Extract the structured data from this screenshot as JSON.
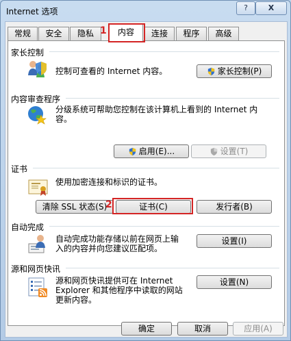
{
  "window": {
    "title": "Internet 选项",
    "help_label": "?",
    "close_label": "X"
  },
  "tabs": [
    {
      "label": "常规"
    },
    {
      "label": "安全"
    },
    {
      "label": "隐私"
    },
    {
      "label": "内容",
      "active": true
    },
    {
      "label": "连接"
    },
    {
      "label": "程序"
    },
    {
      "label": "高级"
    }
  ],
  "markers": {
    "m1": "1",
    "m2": "2",
    "color": "#d42424"
  },
  "parental": {
    "title": "家长控制",
    "description": "控制可查看的 Internet 内容。",
    "button": "家长控制(P)"
  },
  "advisor": {
    "title": "内容审查程序",
    "description_line1": "分级系统可帮助您控制在该计算机上看到的 Internet 内",
    "description_line2": "容。",
    "enable_button": "启用(E)...",
    "settings_button": "设置(T)"
  },
  "certificates": {
    "title": "证书",
    "description": "使用加密连接和标识的证书。",
    "clear_ssl_button": "清除 SSL 状态(S)",
    "certificates_button": "证书(C)",
    "publishers_button": "发行者(B)"
  },
  "autocomplete": {
    "title": "自动完成",
    "description_line1": "自动完成功能存储以前在网页上输",
    "description_line2": "入的内容并向您建议匹配项。",
    "settings_button": "设置(I)"
  },
  "feeds": {
    "title": "源和网页快讯",
    "description_line1": "源和网页快讯提供可在 Internet",
    "description_line2": "Explorer 和其他程序中读取的网站",
    "description_line3": "更新内容。",
    "settings_button": "设置(N)"
  },
  "footer": {
    "ok_button": "确定",
    "cancel_button": "取消",
    "apply_button": "应用(A)"
  }
}
